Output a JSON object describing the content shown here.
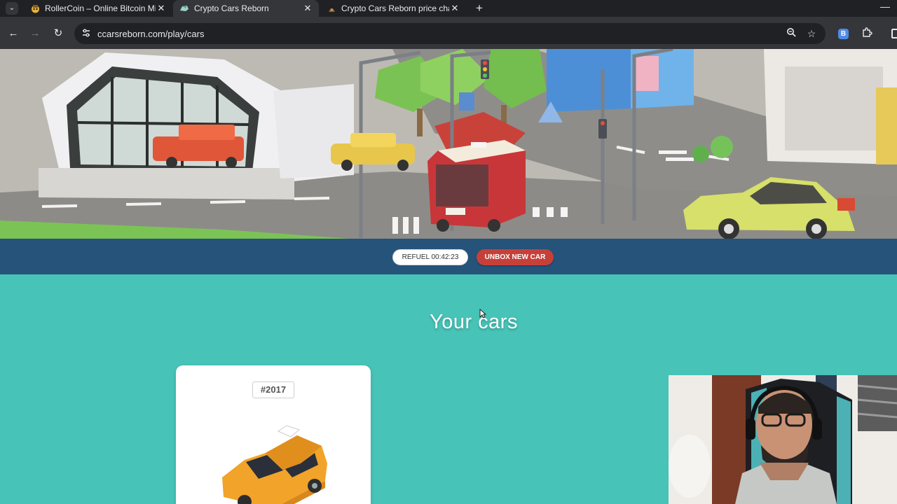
{
  "browser": {
    "tabs": [
      {
        "title": "RollerCoin – Online Bitcoin Mining",
        "active": false
      },
      {
        "title": "Crypto Cars Reborn",
        "active": true
      },
      {
        "title": "Crypto Cars Reborn price chart",
        "active": false
      }
    ],
    "url": "ccarsreborn.com/play/cars"
  },
  "page": {
    "refuel_label": "REFUEL 00:42:23",
    "unbox_label": "UNBOX NEW CAR",
    "section_title": "Your cars",
    "cars": [
      {
        "id_label": "#2017"
      }
    ]
  },
  "colors": {
    "page_bg": "#47c3b8",
    "action_bar": "#25537a",
    "unbox_button": "#c6403a",
    "car_body": "#f2a32a"
  }
}
